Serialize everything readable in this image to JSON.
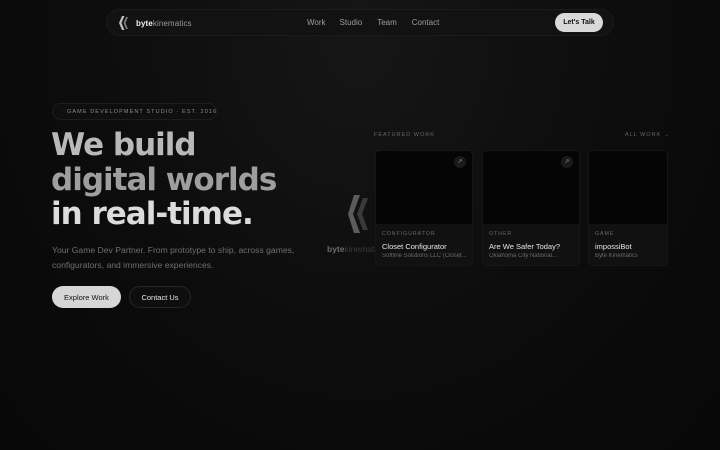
{
  "nav": {
    "brand_bold": "byte",
    "brand_light": "kinematics",
    "links": [
      "Work",
      "Studio",
      "Team",
      "Contact"
    ],
    "cta_label": "Let's Talk"
  },
  "hero": {
    "badge": "GAME DEVELOPMENT STUDIO · EST. 2016",
    "headline_lines": [
      "We build",
      "digital worlds",
      "in real-time."
    ],
    "subtitle": "Your Game Dev Partner. From prototype to ship, across games, configurators, and immersive experiences.",
    "primary_cta": "Explore Work",
    "secondary_cta": "Contact Us"
  },
  "featured": {
    "label": "FEATURED WORK",
    "all_link": "ALL WORK →",
    "logo_bold": "byte",
    "logo_light": "kinematics",
    "cards": [
      {
        "category": "CONFIGURATOR",
        "title": "Closet Configurator",
        "client": "Softline Solutions LLC (Closet...",
        "arrow": "↗"
      },
      {
        "category": "OTHER",
        "title": "Are We Safer Today?",
        "client": "Oklahoma City National...",
        "arrow": "↗"
      },
      {
        "category": "GAME",
        "title": "impossiBot",
        "client": "Byte Kinematics",
        "arrow": ""
      }
    ]
  },
  "colors": {
    "background": "#0a0a0a",
    "cta_bg": "#d9d9d9",
    "card_bg": "#111111"
  }
}
